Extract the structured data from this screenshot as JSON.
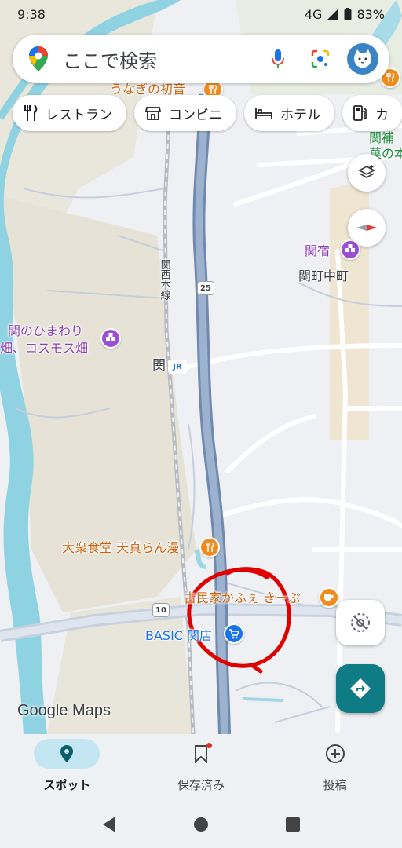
{
  "status_bar": {
    "time": "9:38",
    "network": "4G",
    "battery": "83%"
  },
  "search": {
    "placeholder": "ここで検索"
  },
  "chips": [
    {
      "label": "レストラン",
      "icon": "fork-knife-icon"
    },
    {
      "label": "コンビニ",
      "icon": "store-icon"
    },
    {
      "label": "ホテル",
      "icon": "bed-icon"
    },
    {
      "label": "カ",
      "icon": "gas-station-icon"
    }
  ],
  "map": {
    "labels": {
      "unagi": "うなぎの初音",
      "sekijuku": "関宿",
      "sekimachi": "関町中町",
      "himawari_1": "関のひまわり",
      "himawari_2": "畑、コスモス畑",
      "seki_station": "関",
      "jr": "JR",
      "line": "関西本線",
      "taishu": "大衆食堂 天真らん漫",
      "kominka": "古民家かふぇ きーぷ",
      "basic": "BASIC 関店",
      "top_right_1": "関補",
      "top_right_2": "菓の本",
      "route_25": "25",
      "route_10": "10"
    },
    "annotation_color": "#e00000"
  },
  "watermark": "Google Maps",
  "bottom_nav": [
    {
      "label": "スポット",
      "active": true
    },
    {
      "label": "保存済み",
      "active": false
    },
    {
      "label": "投稿",
      "active": false
    }
  ],
  "colors": {
    "accent": "#0f7c85",
    "purple_poi": "#9c4fd0",
    "orange_poi": "#f28b1f",
    "shop_poi": "#1a73e8",
    "river": "#8fd3e3",
    "highway": "#8fa8c6"
  }
}
